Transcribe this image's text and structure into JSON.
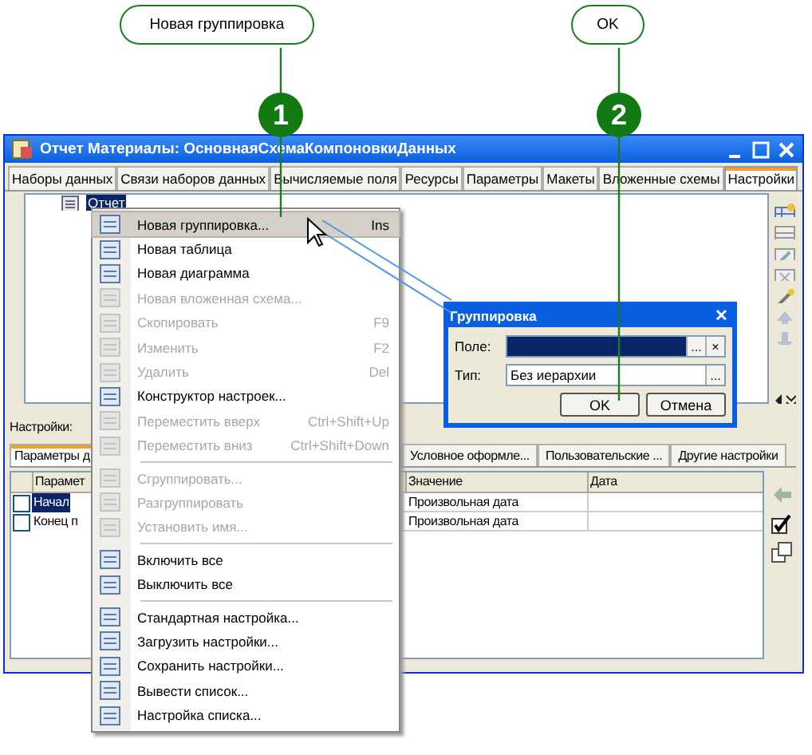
{
  "callouts": [
    {
      "label": "Новая группировка",
      "number": "1"
    },
    {
      "label": "OK",
      "number": "2"
    }
  ],
  "window": {
    "title": "Отчет Материалы: ОсновнаяСхемаКомпоновкиДанных",
    "tabs": [
      {
        "label": "Наборы данных",
        "selected": false
      },
      {
        "label": "Связи наборов данных",
        "selected": false
      },
      {
        "label": "Вычисляемые поля",
        "selected": false
      },
      {
        "label": "Ресурсы",
        "selected": false
      },
      {
        "label": "Параметры",
        "selected": false
      },
      {
        "label": "Макеты",
        "selected": false
      },
      {
        "label": "Вложенные схемы",
        "selected": false
      },
      {
        "label": "Настройки",
        "selected": true
      }
    ],
    "tree_item": {
      "label": "Отчет",
      "selected": true
    },
    "settings_label": "Настройки:",
    "lower_tabs": [
      {
        "label": "Параметры д",
        "selected": true
      },
      {
        "label": "Условное оформле...",
        "selected": false
      },
      {
        "label": "Пользовательские ...",
        "selected": false
      },
      {
        "label": "Другие настройки",
        "selected": false
      }
    ],
    "table": {
      "columns": [
        "Парамет",
        "Значение",
        "Дата"
      ],
      "rows": [
        {
          "checked": false,
          "selected": true,
          "cells": [
            "Начал",
            "Произвольная дата",
            ""
          ]
        },
        {
          "checked": false,
          "selected": false,
          "cells": [
            "Конец п",
            "Произвольная дата",
            ""
          ]
        }
      ]
    }
  },
  "context_menu": {
    "items": [
      {
        "kind": "item",
        "label": "Новая группировка...",
        "shortcut": "Ins",
        "disabled": false,
        "selected": true
      },
      {
        "kind": "item",
        "label": "Новая таблица",
        "disabled": false,
        "selected": false
      },
      {
        "kind": "item",
        "label": "Новая диаграмма",
        "disabled": false,
        "selected": false
      },
      {
        "kind": "item",
        "label": "Новая вложенная схема...",
        "disabled": true,
        "selected": false
      },
      {
        "kind": "item",
        "label": "Скопировать",
        "shortcut": "F9",
        "disabled": true,
        "selected": false
      },
      {
        "kind": "item",
        "label": "Изменить",
        "shortcut": "F2",
        "disabled": true,
        "selected": false
      },
      {
        "kind": "item",
        "label": "Удалить",
        "shortcut": "Del",
        "disabled": true,
        "selected": false
      },
      {
        "kind": "item",
        "label": "Конструктор настроек...",
        "disabled": false,
        "selected": false
      },
      {
        "kind": "item",
        "label": "Переместить вверх",
        "shortcut": "Ctrl+Shift+Up",
        "disabled": true,
        "selected": false
      },
      {
        "kind": "item",
        "label": "Переместить вниз",
        "shortcut": "Ctrl+Shift+Down",
        "disabled": true,
        "selected": false
      },
      {
        "kind": "separator"
      },
      {
        "kind": "item",
        "label": "Сгруппировать...",
        "disabled": true,
        "selected": false
      },
      {
        "kind": "item",
        "label": "Разгруппировать",
        "disabled": true,
        "selected": false
      },
      {
        "kind": "item",
        "label": "Установить имя...",
        "disabled": true,
        "selected": false
      },
      {
        "kind": "separator"
      },
      {
        "kind": "item",
        "label": "Включить все",
        "disabled": false,
        "selected": false
      },
      {
        "kind": "item",
        "label": "Выключить все",
        "disabled": false,
        "selected": false
      },
      {
        "kind": "separator"
      },
      {
        "kind": "item",
        "label": "Стандартная настройка...",
        "disabled": false,
        "selected": false
      },
      {
        "kind": "item",
        "label": "Загрузить настройки...",
        "disabled": false,
        "selected": false
      },
      {
        "kind": "item",
        "label": "Сохранить настройки...",
        "disabled": false,
        "selected": false
      },
      {
        "kind": "item",
        "label": "Вывести список...",
        "disabled": false,
        "selected": false
      },
      {
        "kind": "item",
        "label": "Настройка списка...",
        "disabled": false,
        "selected": false
      }
    ]
  },
  "dialog": {
    "title": "Группировка",
    "close": "✕",
    "fields": [
      {
        "label": "Поле:",
        "selected": true,
        "clear": "×"
      },
      {
        "label": "Тип:",
        "value": "Без иерархии",
        "selected": false
      }
    ],
    "browse": "...",
    "buttons": [
      "OK",
      "Отмена"
    ]
  }
}
